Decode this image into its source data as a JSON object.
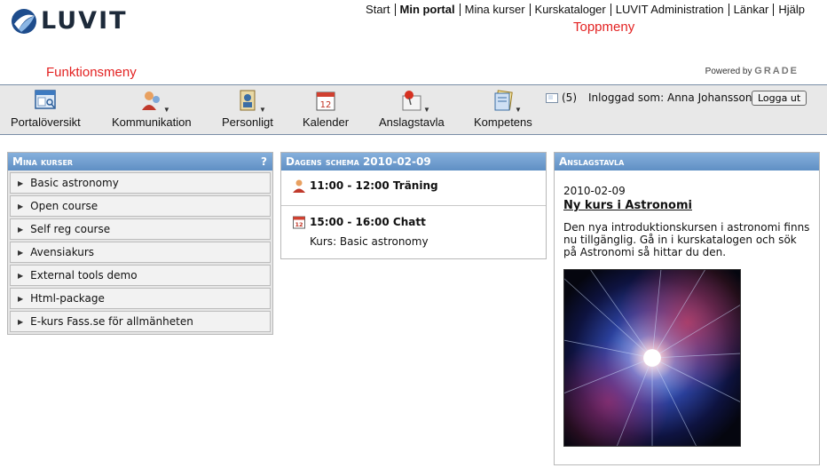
{
  "brand": {
    "logo_text": "LUVIT"
  },
  "topnav": {
    "items": [
      "Start",
      "Min portal",
      "Mina kurser",
      "Kurskataloger",
      "LUVIT Administration",
      "Länkar",
      "Hjälp"
    ],
    "active_index": 1
  },
  "labels": {
    "toppmeny": "Toppmeny",
    "funktionsmeny": "Funktionsmeny"
  },
  "powered": {
    "prefix": "Powered by",
    "brand": "GRADE"
  },
  "toolbar": {
    "items": [
      "Portalöversikt",
      "Kommunikation",
      "Personligt",
      "Kalender",
      "Anslagstavla",
      "Kompetens"
    ],
    "mail_count": "(5)",
    "logged_in": "Inloggad som: Anna Johansson",
    "logout_label": "Logga ut"
  },
  "courses": {
    "title": "Mina kurser",
    "help": "?",
    "items": [
      "Basic astronomy",
      "Open course",
      "Self reg course",
      "Avensiakurs",
      "External tools demo",
      "Html-package",
      "E-kurs Fass.se för allmänheten"
    ]
  },
  "schedule": {
    "title": "Dagens schema 2010-02-09",
    "entries": [
      {
        "time": "11:00 - 12:00 Träning",
        "icon": "person-icon"
      },
      {
        "time": "15:00 - 16:00 Chatt",
        "icon": "calendar-icon",
        "sub": "Kurs: Basic astronomy"
      }
    ]
  },
  "anslagstavla": {
    "title": "Anslagstavla",
    "date": "2010-02-09",
    "headline": "Ny kurs i Astronomi",
    "text": "Den nya introduktionskursen i astronomi finns nu tillgänglig. Gå in i kurskatalogen och sök på Astronomi så hittar du den.",
    "image": "starburst-space-image"
  },
  "colors": {
    "accent_red": "#e32222",
    "panel_head": "#6f9ccf"
  }
}
